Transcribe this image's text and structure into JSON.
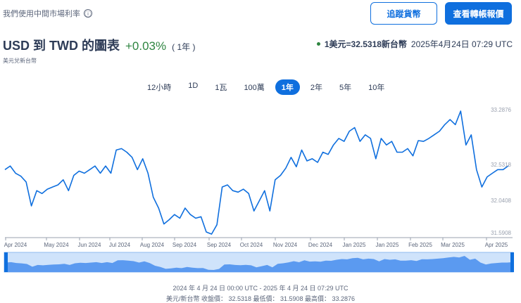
{
  "header": {
    "note": "我們使用中間市場利率",
    "info_icon": "ⓘ",
    "track_button": "追蹤貨幣",
    "quote_button": "查看轉帳報價"
  },
  "title": {
    "main": "USD 到 TWD 的圖表",
    "change": "+0.03%",
    "period": "( 1年 )",
    "subtitle": "美元兌新台幣"
  },
  "rate": {
    "value": "1美元=32.5318新台幣",
    "time": "2025年4月24日 07:29 UTC"
  },
  "tabs": [
    {
      "label": "12小時"
    },
    {
      "label": "1D"
    },
    {
      "label": "1瓦"
    },
    {
      "label": "100萬"
    },
    {
      "label": "1年",
      "active": true
    },
    {
      "label": "2年"
    },
    {
      "label": "5年"
    },
    {
      "label": "10年"
    }
  ],
  "colors": {
    "accent": "#0f6fde",
    "positive": "#2e8540",
    "nav_fill": "#5b9af0",
    "nav_bg": "#cfe3fb"
  },
  "chart_data": {
    "type": "line",
    "title": "USD 到 TWD",
    "ylim": [
      31.5908,
      33.2876
    ],
    "y_ticks": [
      "33.2876",
      "32.5318",
      "32.0408",
      "31.5908"
    ],
    "x_ticks": [
      "Apr 2024",
      "May 2024",
      "Jun 2024",
      "Jul 2024",
      "Aug 2024",
      "Sep 2024",
      "Sep 2024",
      "Oct 2024",
      "Nov 2024",
      "Dec 2024",
      "Jan 2025",
      "Jan 2025",
      "Feb 2025",
      "Mar 2025",
      "Apr 2025"
    ],
    "values": [
      32.48,
      32.53,
      32.43,
      32.39,
      32.31,
      31.98,
      32.19,
      32.15,
      32.21,
      32.24,
      32.27,
      32.34,
      32.19,
      32.4,
      32.46,
      32.43,
      32.48,
      32.53,
      32.43,
      32.53,
      32.43,
      32.75,
      32.77,
      32.72,
      32.65,
      32.48,
      32.63,
      32.43,
      32.1,
      31.95,
      31.73,
      31.79,
      31.86,
      31.81,
      31.95,
      31.86,
      31.81,
      31.83,
      31.62,
      31.5908,
      31.72,
      32.24,
      32.27,
      32.19,
      32.17,
      32.21,
      32.15,
      31.91,
      32.05,
      32.19,
      31.91,
      32.34,
      32.4,
      32.5,
      32.65,
      32.52,
      32.75,
      32.6,
      32.63,
      32.58,
      32.72,
      32.69,
      32.82,
      32.91,
      32.87,
      33.01,
      33.06,
      32.87,
      32.96,
      32.91,
      32.63,
      32.91,
      32.82,
      32.87,
      32.72,
      32.72,
      32.77,
      32.67,
      32.88,
      32.87,
      32.91,
      32.96,
      33.01,
      33.1,
      33.17,
      33.1,
      33.2876,
      32.82,
      32.96,
      32.48,
      32.24,
      32.38,
      32.43,
      32.48,
      32.48,
      32.5318
    ]
  },
  "footer": {
    "range": "2024 年 4 月 24 日 00:00 UTC - 2025 年 4 月 24 日 07:29 UTC",
    "stats": "美元/新台幣 收盤價： 32.5318 最低價： 31.5908 最高價： 33.2876"
  }
}
